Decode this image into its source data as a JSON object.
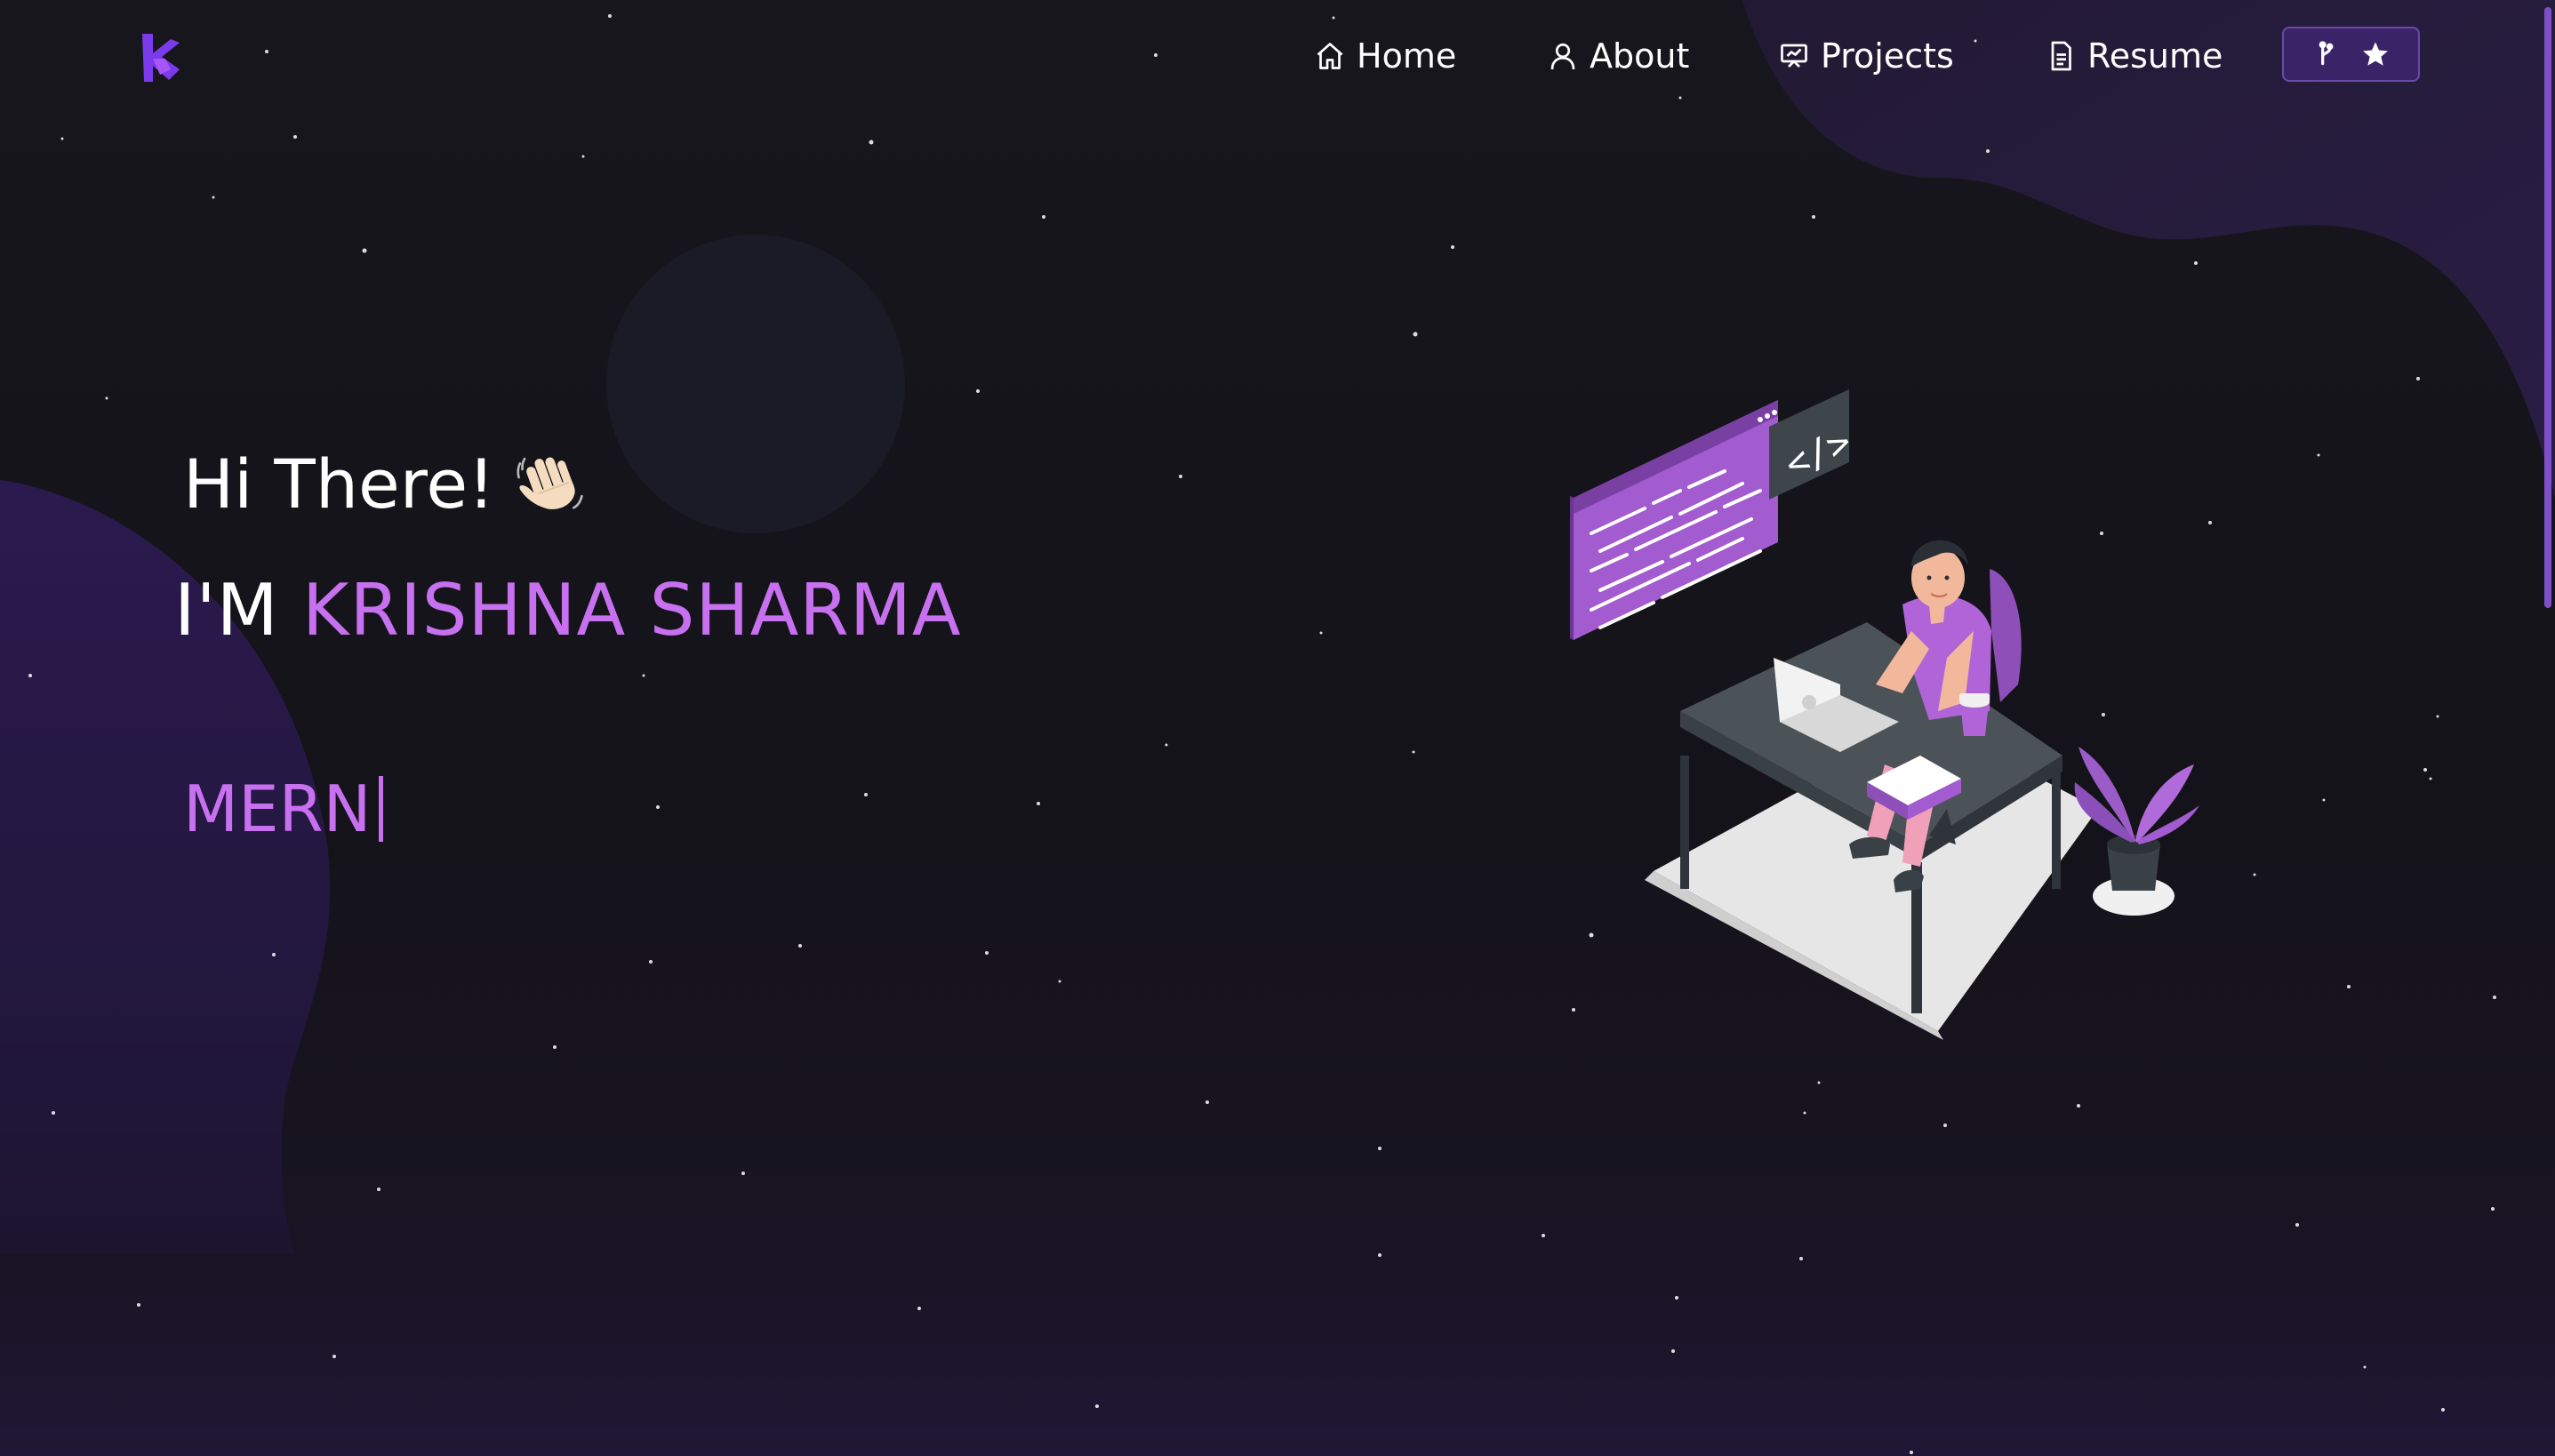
{
  "navbar": {
    "logo_icon": "ks-monogram-logo",
    "items": [
      {
        "label": "Home",
        "icon": "home-icon"
      },
      {
        "label": "About",
        "icon": "user-icon"
      },
      {
        "label": "Projects",
        "icon": "presentation-icon"
      },
      {
        "label": "Resume",
        "icon": "document-icon"
      }
    ],
    "fork_button": {
      "icons": [
        "git-fork-icon",
        "star-icon"
      ]
    }
  },
  "hero": {
    "greeting": "Hi There!",
    "greeting_emoji": "waving-hand-icon",
    "intro_prefix": "I'M",
    "name": "KRISHNA SHARMA",
    "typed_text": "MERN"
  },
  "illustration": "developer-at-desk-illustration",
  "colors": {
    "background": "#16151d",
    "accent": "#c770f0",
    "button_bg": "#3a2467",
    "blob": "#2a1a4a"
  }
}
